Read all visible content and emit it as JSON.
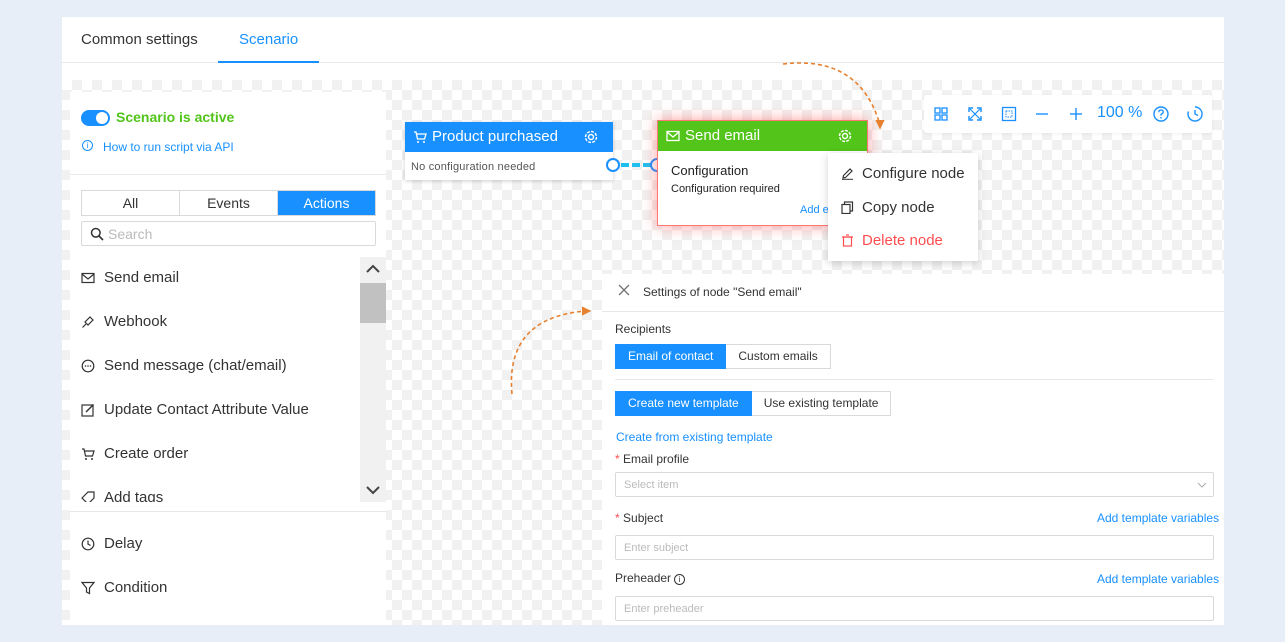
{
  "tabs": [
    {
      "label": "Common settings",
      "active": false
    },
    {
      "label": "Scenario",
      "active": true
    }
  ],
  "left_panel": {
    "status_label": "Scenario is active",
    "api_link": "How to run script via API",
    "filter_tabs": [
      "All",
      "Events",
      "Actions"
    ],
    "active_filter": "Actions",
    "search_placeholder": "Search",
    "items": [
      {
        "label": "Send email",
        "icon": "mail-icon"
      },
      {
        "label": "Webhook",
        "icon": "webhook-icon"
      },
      {
        "label": "Send message (chat/email)",
        "icon": "chat-icon"
      },
      {
        "label": "Update Contact Attribute Value",
        "icon": "edit-icon"
      },
      {
        "label": "Create order",
        "icon": "cart-icon"
      },
      {
        "label": "Add tags",
        "icon": "tag-icon"
      }
    ],
    "bottom_items": [
      {
        "label": "Delay",
        "icon": "clock-icon"
      },
      {
        "label": "Condition",
        "icon": "filter-icon"
      }
    ]
  },
  "nodes": {
    "product_purchased": {
      "title": "Product purchased",
      "subtitle": "No configuration needed"
    },
    "send_email": {
      "title": "Send email",
      "config_title": "Configuration",
      "config_sub": "Configuration required",
      "add_link": "Add e"
    }
  },
  "context_menu": [
    {
      "label": "Configure node",
      "icon": "pencil-icon",
      "danger": false
    },
    {
      "label": "Copy node",
      "icon": "copy-icon",
      "danger": false
    },
    {
      "label": "Delete node",
      "icon": "trash-icon",
      "danger": true
    }
  ],
  "toolbar": {
    "zoom": "100 %"
  },
  "settings": {
    "title": "Settings of node \"Send email\"",
    "recipients_label": "Recipients",
    "recipient_options": [
      "Email of contact",
      "Custom emails"
    ],
    "recipient_active": "Email of contact",
    "template_options": [
      "Create new template",
      "Use existing template"
    ],
    "template_active": "Create new template",
    "create_from_link": "Create from existing template",
    "email_profile_label": "Email profile",
    "email_profile_placeholder": "Select item",
    "subject_label": "Subject",
    "subject_placeholder": "Enter subject",
    "add_vars_link": "Add template variables",
    "preheader_label": "Preheader",
    "preheader_placeholder": "Enter preheader"
  },
  "colors": {
    "primary": "#1890ff",
    "success": "#52c41a",
    "danger": "#ff4d4f",
    "arrow": "#e8812f"
  }
}
